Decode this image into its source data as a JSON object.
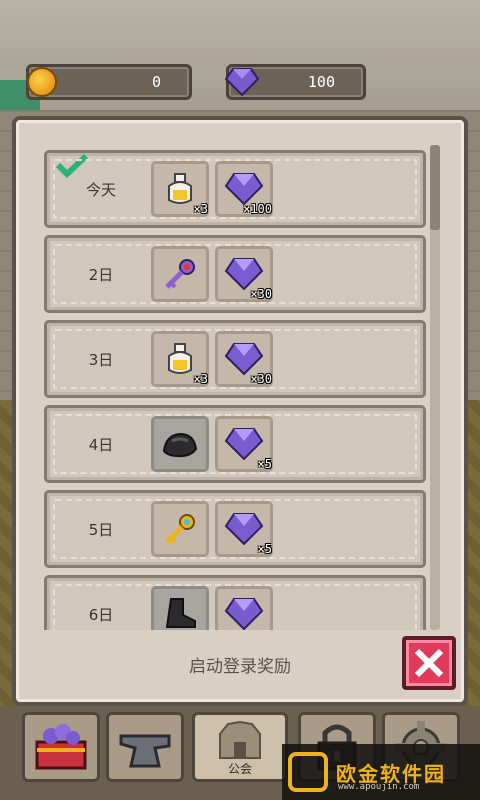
{
  "colors": {
    "panel": "#d9cfc5",
    "close": "#e23a5a",
    "check": "#2eb07a",
    "gem": "#8d6be0"
  },
  "currency": {
    "gold": {
      "icon": "gold-coin-icon",
      "value": "0"
    },
    "gems": {
      "icon": "purple-gem-icon",
      "value": "100"
    }
  },
  "panel": {
    "title": "启动登录奖励"
  },
  "days": [
    {
      "label": "今天",
      "claimed": true,
      "rewards": [
        {
          "icon": "potion-icon",
          "count": "×3"
        },
        {
          "icon": "purple-gem-icon",
          "count": "×100"
        }
      ]
    },
    {
      "label": "2日",
      "claimed": false,
      "rewards": [
        {
          "icon": "purple-key-icon",
          "count": ""
        },
        {
          "icon": "purple-gem-icon",
          "count": "×30"
        }
      ]
    },
    {
      "label": "3日",
      "claimed": false,
      "rewards": [
        {
          "icon": "potion-icon",
          "count": "×3"
        },
        {
          "icon": "purple-gem-icon",
          "count": "×30"
        }
      ]
    },
    {
      "label": "4日",
      "claimed": false,
      "rewards": [
        {
          "icon": "coal-ore-icon",
          "count": ""
        },
        {
          "icon": "purple-gem-icon",
          "count": "×5"
        }
      ]
    },
    {
      "label": "5日",
      "claimed": false,
      "rewards": [
        {
          "icon": "gold-key-icon",
          "count": ""
        },
        {
          "icon": "purple-gem-icon",
          "count": "×5"
        }
      ]
    },
    {
      "label": "6日",
      "claimed": false,
      "rewards": [
        {
          "icon": "dark-boot-icon",
          "count": ""
        },
        {
          "icon": "purple-gem-icon",
          "count": ""
        }
      ]
    }
  ],
  "tabs": [
    {
      "icon": "treasure-chest-icon",
      "label": ""
    },
    {
      "icon": "anvil-icon",
      "label": ""
    },
    {
      "icon": "castle-icon",
      "label": "公会"
    },
    {
      "icon": "padlock-icon",
      "label": ""
    },
    {
      "icon": "gear-icon",
      "label": ""
    }
  ],
  "watermark": {
    "title": "欧金软件园",
    "url": "www.apoujin.com"
  }
}
